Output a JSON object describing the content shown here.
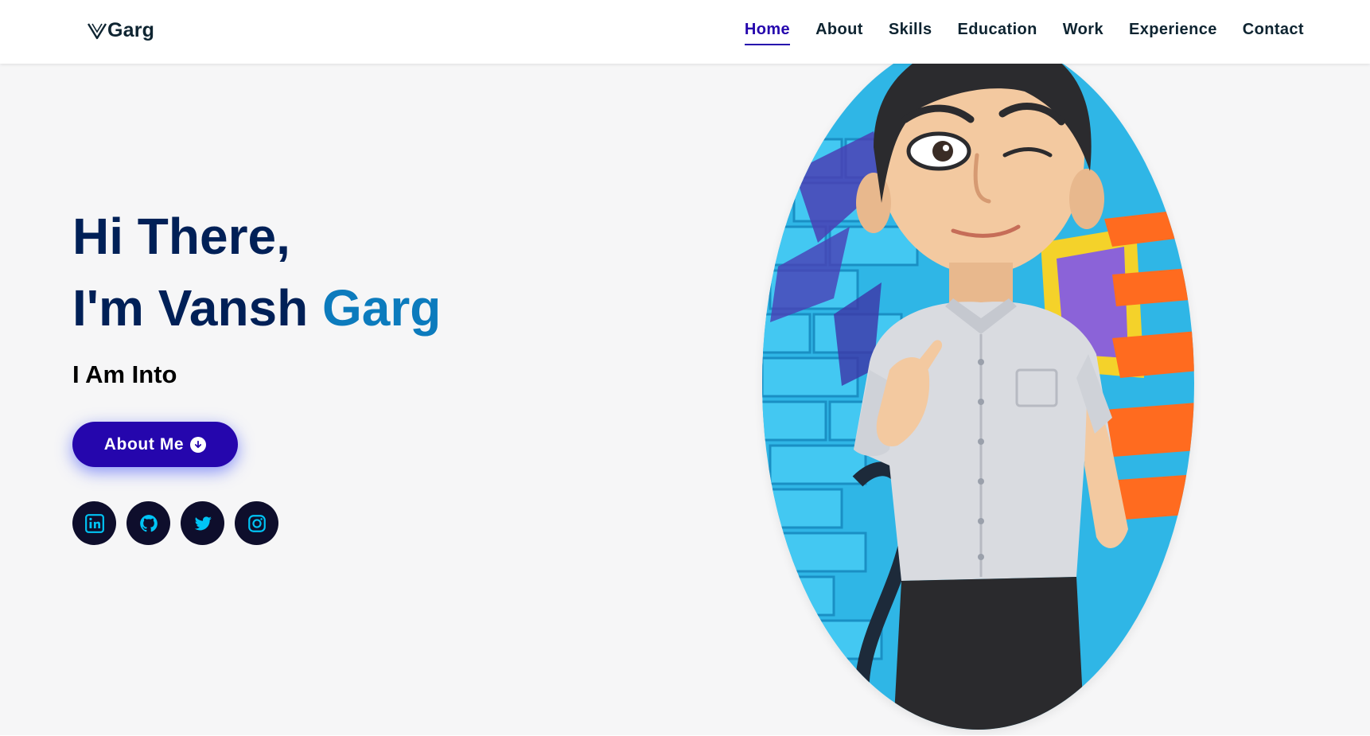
{
  "brand": {
    "text": "Garg",
    "logo_icon": "v-logo-icon"
  },
  "nav": {
    "items": [
      {
        "label": "Home",
        "active": true
      },
      {
        "label": "About"
      },
      {
        "label": "Skills"
      },
      {
        "label": "Education"
      },
      {
        "label": "Work"
      },
      {
        "label": "Experience"
      },
      {
        "label": "Contact"
      }
    ]
  },
  "hero": {
    "greeting": "Hi There,",
    "name_prefix": "I'm Vansh ",
    "name_highlight": "Garg",
    "tagline": "I Am Into",
    "button": {
      "label": "About Me",
      "icon": "arrow-down-circle-icon"
    }
  },
  "socials": [
    {
      "name": "LinkedIn",
      "icon": "linkedin-icon"
    },
    {
      "name": "GitHub",
      "icon": "github-icon"
    },
    {
      "name": "Twitter",
      "icon": "twitter-icon"
    },
    {
      "name": "Instagram",
      "icon": "instagram-icon"
    }
  ],
  "colors": {
    "primary_dark": "#002057",
    "accent_blue": "#0c7bbd",
    "button_purple": "#2506ad",
    "nav_active": "#2506ad",
    "social_bg": "#0e0e2c",
    "social_icon": "#00c4f5",
    "page_bg": "#f6f6f7"
  }
}
